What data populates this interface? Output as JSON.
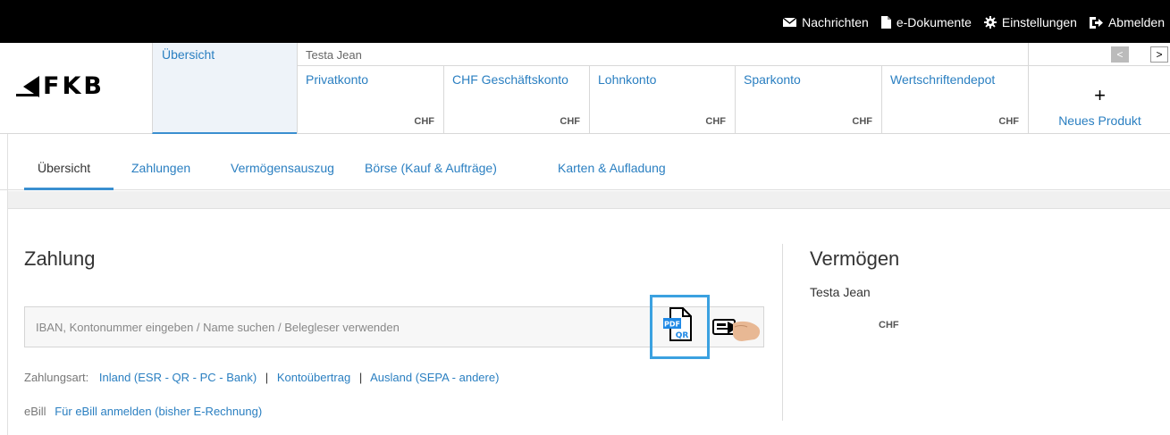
{
  "topbar": {
    "items": [
      {
        "label": "Nachrichten",
        "icon": "envelope-icon"
      },
      {
        "label": "e-Dokumente",
        "icon": "document-icon"
      },
      {
        "label": "Einstellungen",
        "icon": "gear-icon"
      },
      {
        "label": "Abmelden",
        "icon": "logout-icon"
      }
    ]
  },
  "brand": {
    "name": "FKB"
  },
  "header": {
    "overview_tab": "Übersicht",
    "owner": "Testa Jean",
    "accounts": [
      {
        "name": "Privatkonto",
        "currency": "CHF"
      },
      {
        "name": "CHF Geschäftskonto",
        "currency": "CHF"
      },
      {
        "name": "Lohnkonto",
        "currency": "CHF"
      },
      {
        "name": "Sparkonto",
        "currency": "CHF"
      },
      {
        "name": "Wertschriftendepot",
        "currency": "CHF"
      }
    ],
    "new_product_plus": "+",
    "new_product": "Neues Produkt",
    "prev_arrow": "<",
    "next_arrow": ">"
  },
  "nav": {
    "items": [
      "Übersicht",
      "Zahlungen",
      "Vermögensauszug",
      "Börse (Kauf & Aufträge)",
      "Karten & Aufladung"
    ]
  },
  "zahlung": {
    "title": "Zahlung",
    "search_placeholder": "IBAN, Kontonummer eingeben / Name suchen / Belegleser verwenden",
    "qr_pdf_label": "PDF",
    "qr_label": "QR",
    "zahlungsart_label": "Zahlungsart:",
    "zahlungsart_links": [
      "Inland (ESR - QR - PC - Bank)",
      "Kontoübertrag",
      "Ausland (SEPA - andere)"
    ],
    "separator": "|",
    "ebill_label": "eBill",
    "ebill_link": "Für eBill anmelden (bisher E-Rechnung)"
  },
  "vermoegen": {
    "title": "Vermögen",
    "owner": "Testa Jean",
    "currency": "CHF"
  },
  "colors": {
    "accent": "#2a7fc1",
    "highlight": "#3ba1e0",
    "topbar": "#000000"
  }
}
